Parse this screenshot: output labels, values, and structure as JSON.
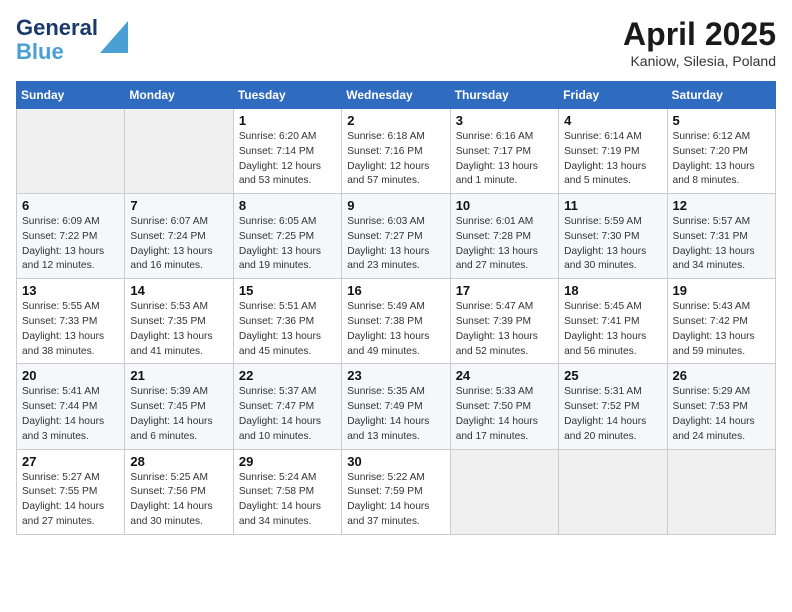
{
  "logo": {
    "line1": "General",
    "line2": "Blue"
  },
  "title": "April 2025",
  "location": "Kaniow, Silesia, Poland",
  "days_of_week": [
    "Sunday",
    "Monday",
    "Tuesday",
    "Wednesday",
    "Thursday",
    "Friday",
    "Saturday"
  ],
  "weeks": [
    [
      {
        "day": "",
        "detail": ""
      },
      {
        "day": "",
        "detail": ""
      },
      {
        "day": "1",
        "detail": "Sunrise: 6:20 AM\nSunset: 7:14 PM\nDaylight: 12 hours\nand 53 minutes."
      },
      {
        "day": "2",
        "detail": "Sunrise: 6:18 AM\nSunset: 7:16 PM\nDaylight: 12 hours\nand 57 minutes."
      },
      {
        "day": "3",
        "detail": "Sunrise: 6:16 AM\nSunset: 7:17 PM\nDaylight: 13 hours\nand 1 minute."
      },
      {
        "day": "4",
        "detail": "Sunrise: 6:14 AM\nSunset: 7:19 PM\nDaylight: 13 hours\nand 5 minutes."
      },
      {
        "day": "5",
        "detail": "Sunrise: 6:12 AM\nSunset: 7:20 PM\nDaylight: 13 hours\nand 8 minutes."
      }
    ],
    [
      {
        "day": "6",
        "detail": "Sunrise: 6:09 AM\nSunset: 7:22 PM\nDaylight: 13 hours\nand 12 minutes."
      },
      {
        "day": "7",
        "detail": "Sunrise: 6:07 AM\nSunset: 7:24 PM\nDaylight: 13 hours\nand 16 minutes."
      },
      {
        "day": "8",
        "detail": "Sunrise: 6:05 AM\nSunset: 7:25 PM\nDaylight: 13 hours\nand 19 minutes."
      },
      {
        "day": "9",
        "detail": "Sunrise: 6:03 AM\nSunset: 7:27 PM\nDaylight: 13 hours\nand 23 minutes."
      },
      {
        "day": "10",
        "detail": "Sunrise: 6:01 AM\nSunset: 7:28 PM\nDaylight: 13 hours\nand 27 minutes."
      },
      {
        "day": "11",
        "detail": "Sunrise: 5:59 AM\nSunset: 7:30 PM\nDaylight: 13 hours\nand 30 minutes."
      },
      {
        "day": "12",
        "detail": "Sunrise: 5:57 AM\nSunset: 7:31 PM\nDaylight: 13 hours\nand 34 minutes."
      }
    ],
    [
      {
        "day": "13",
        "detail": "Sunrise: 5:55 AM\nSunset: 7:33 PM\nDaylight: 13 hours\nand 38 minutes."
      },
      {
        "day": "14",
        "detail": "Sunrise: 5:53 AM\nSunset: 7:35 PM\nDaylight: 13 hours\nand 41 minutes."
      },
      {
        "day": "15",
        "detail": "Sunrise: 5:51 AM\nSunset: 7:36 PM\nDaylight: 13 hours\nand 45 minutes."
      },
      {
        "day": "16",
        "detail": "Sunrise: 5:49 AM\nSunset: 7:38 PM\nDaylight: 13 hours\nand 49 minutes."
      },
      {
        "day": "17",
        "detail": "Sunrise: 5:47 AM\nSunset: 7:39 PM\nDaylight: 13 hours\nand 52 minutes."
      },
      {
        "day": "18",
        "detail": "Sunrise: 5:45 AM\nSunset: 7:41 PM\nDaylight: 13 hours\nand 56 minutes."
      },
      {
        "day": "19",
        "detail": "Sunrise: 5:43 AM\nSunset: 7:42 PM\nDaylight: 13 hours\nand 59 minutes."
      }
    ],
    [
      {
        "day": "20",
        "detail": "Sunrise: 5:41 AM\nSunset: 7:44 PM\nDaylight: 14 hours\nand 3 minutes."
      },
      {
        "day": "21",
        "detail": "Sunrise: 5:39 AM\nSunset: 7:45 PM\nDaylight: 14 hours\nand 6 minutes."
      },
      {
        "day": "22",
        "detail": "Sunrise: 5:37 AM\nSunset: 7:47 PM\nDaylight: 14 hours\nand 10 minutes."
      },
      {
        "day": "23",
        "detail": "Sunrise: 5:35 AM\nSunset: 7:49 PM\nDaylight: 14 hours\nand 13 minutes."
      },
      {
        "day": "24",
        "detail": "Sunrise: 5:33 AM\nSunset: 7:50 PM\nDaylight: 14 hours\nand 17 minutes."
      },
      {
        "day": "25",
        "detail": "Sunrise: 5:31 AM\nSunset: 7:52 PM\nDaylight: 14 hours\nand 20 minutes."
      },
      {
        "day": "26",
        "detail": "Sunrise: 5:29 AM\nSunset: 7:53 PM\nDaylight: 14 hours\nand 24 minutes."
      }
    ],
    [
      {
        "day": "27",
        "detail": "Sunrise: 5:27 AM\nSunset: 7:55 PM\nDaylight: 14 hours\nand 27 minutes."
      },
      {
        "day": "28",
        "detail": "Sunrise: 5:25 AM\nSunset: 7:56 PM\nDaylight: 14 hours\nand 30 minutes."
      },
      {
        "day": "29",
        "detail": "Sunrise: 5:24 AM\nSunset: 7:58 PM\nDaylight: 14 hours\nand 34 minutes."
      },
      {
        "day": "30",
        "detail": "Sunrise: 5:22 AM\nSunset: 7:59 PM\nDaylight: 14 hours\nand 37 minutes."
      },
      {
        "day": "",
        "detail": ""
      },
      {
        "day": "",
        "detail": ""
      },
      {
        "day": "",
        "detail": ""
      }
    ]
  ]
}
